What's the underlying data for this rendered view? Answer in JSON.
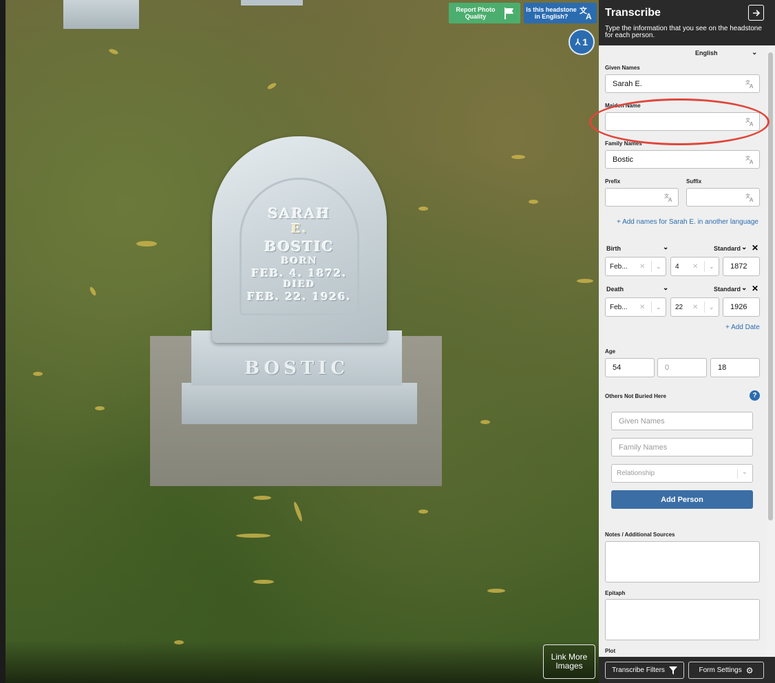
{
  "photo": {
    "stone_lines": [
      "SARAH",
      "E.",
      "BOSTIC",
      "BORN",
      "FEB. 4. 1872.",
      "DIED",
      "FEB. 22. 1926."
    ],
    "stone_base_text": "BOSTIC",
    "report_button": "Report Photo Quality",
    "english_button": "Is this headstone in English?",
    "person_count": "1",
    "link_more": "Link More Images"
  },
  "panel": {
    "title": "Transcribe",
    "subtitle": "Type the information that you see on the headstone for each person.",
    "language": "English",
    "given_names_label": "Given Names",
    "given_names_value": "Sarah E.",
    "maiden_name_label": "Maiden Name",
    "maiden_name_value": "",
    "family_names_label": "Family Names",
    "family_names_value": "Bostic",
    "prefix_label": "Prefix",
    "suffix_label": "Suffix",
    "add_names_link": "+ Add names for Sarah E. in another language",
    "birth": {
      "label": "Birth",
      "standard": "Standard",
      "month": "Feb...",
      "day": "4",
      "year": "1872"
    },
    "death": {
      "label": "Death",
      "standard": "Standard",
      "month": "Feb...",
      "day": "22",
      "year": "1926"
    },
    "add_date": "+ Add Date",
    "age_label": "Age",
    "age": {
      "years": "54",
      "months": "0",
      "days": "18"
    },
    "others_label": "Others Not Buried Here",
    "others_given_placeholder": "Given Names",
    "others_family_placeholder": "Family Names",
    "relationship_placeholder": "Relationship",
    "add_person": "Add Person",
    "notes_label": "Notes / Additional Sources",
    "epitaph_label": "Epitaph",
    "plot_label": "Plot",
    "transcribe_filters": "Transcribe Filters",
    "form_settings": "Form Settings"
  },
  "colors": {
    "accent": "#2b6cb0",
    "green": "#4cae6e",
    "annotation": "#e0463a"
  }
}
